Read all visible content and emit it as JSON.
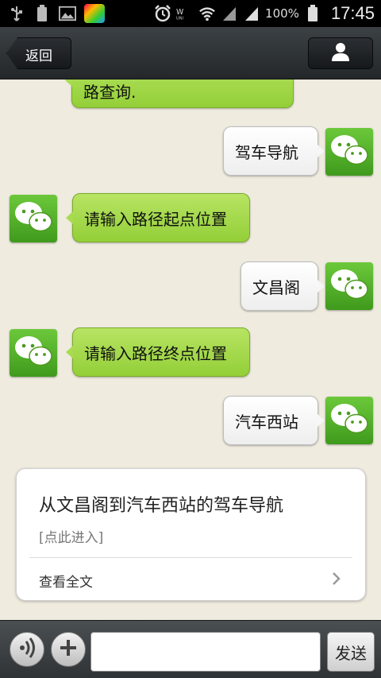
{
  "status_bar": {
    "battery_percent": "100%",
    "time": "17:45",
    "icons": [
      "usb-icon",
      "battery-icon",
      "gallery-icon",
      "app-icon",
      "alarm-icon",
      "carrier-icon",
      "wifi-icon",
      "signal-icon",
      "signal-icon",
      "battery-icon"
    ]
  },
  "nav": {
    "back_label": "返回",
    "profile_icon": "person-icon"
  },
  "messages": [
    {
      "side": "left",
      "kind": "bot",
      "text": "路查询."
    },
    {
      "side": "right",
      "kind": "user",
      "text": "驾车导航"
    },
    {
      "side": "left",
      "kind": "bot",
      "text": "请输入路径起点位置"
    },
    {
      "side": "right",
      "kind": "user",
      "text": "文昌阁"
    },
    {
      "side": "left",
      "kind": "bot",
      "text": "请输入路径终点位置"
    },
    {
      "side": "right",
      "kind": "user",
      "text": "汽车西站"
    }
  ],
  "card": {
    "title": "从文昌阁到汽车西站的驾车导航",
    "subtitle": "[点此进入]",
    "link_label": "查看全文"
  },
  "composer": {
    "input_value": "",
    "send_label": "发送"
  },
  "colors": {
    "bubble_green": "#a6d94f",
    "background": "#efebdf",
    "avatar_green": "#55b52b"
  }
}
